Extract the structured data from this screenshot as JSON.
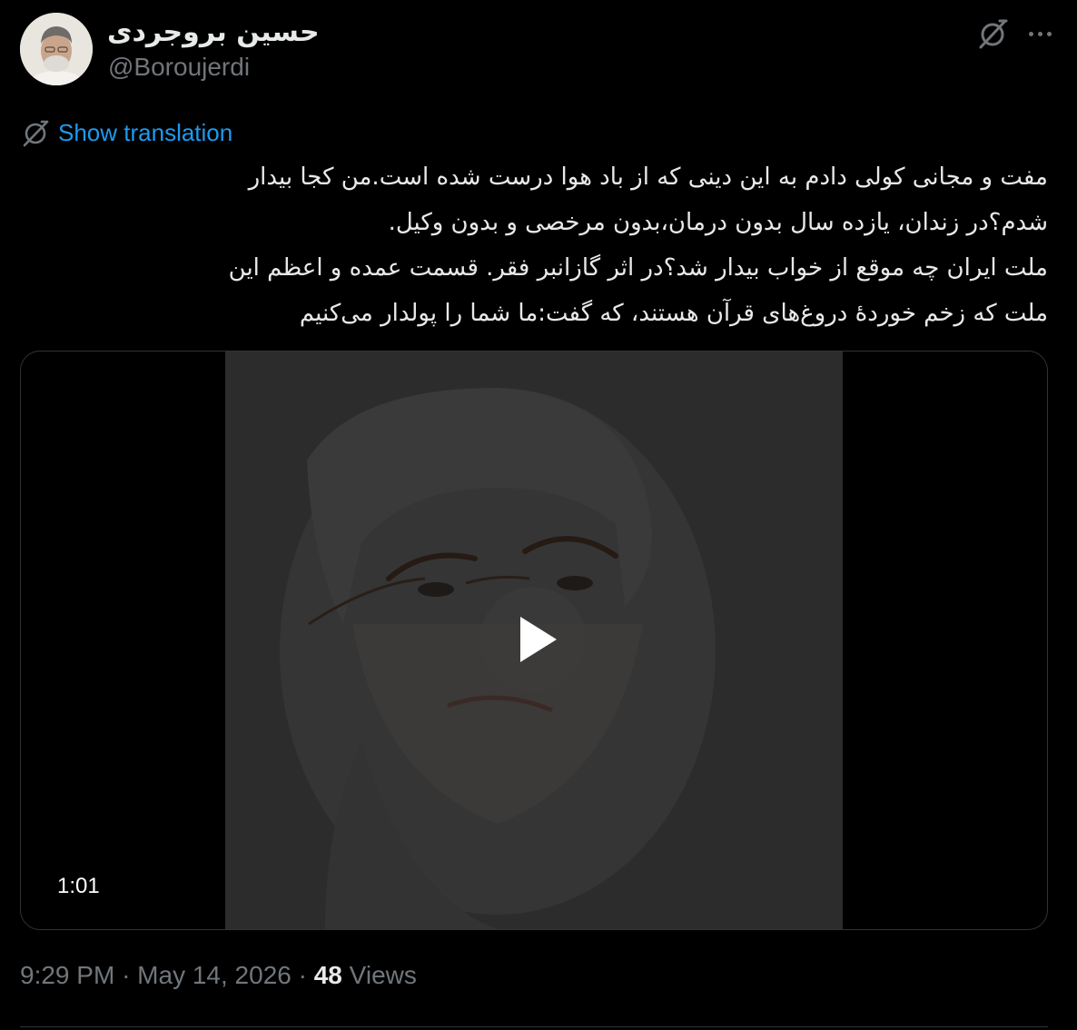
{
  "tweet": {
    "author": {
      "display_name": "حسین بروجردی",
      "handle": "@Boroujerdi",
      "avatar_icon": "user-avatar-photo"
    },
    "header_icons": {
      "grok": "grok-icon",
      "more": "more-horizontal-icon"
    },
    "translation": {
      "icon": "translate-globe-icon",
      "label": "Show translation"
    },
    "text_lines": [
      "مفت و مجانی کولی دادم به این دینی که از باد هوا درست شده است.من کجا بیدار",
      "شدم؟در زندان، یازده سال بدون درمان،بدون مرخصی و بدون وکیل.",
      "ملت ایران چه موقع از خواب بیدار شد؟در اثر گازانبر فقر. قسمت عمده و اعظم این",
      "ملت که زخم خوردهٔ دروغ‌های قرآن هستند، که گفت:ما شما را پولدار می‌کنیم"
    ],
    "media": {
      "type": "video",
      "duration": "1:01",
      "play_icon": "play-icon"
    },
    "meta": {
      "time": "9:29 PM",
      "separator": "·",
      "date": "May 14, 2026",
      "views_count": "48",
      "views_label": "Views"
    },
    "colors": {
      "background": "#000000",
      "text": "#e7e9ea",
      "secondary": "#71767b",
      "link": "#1d9bf0",
      "border": "#2f3336"
    }
  }
}
